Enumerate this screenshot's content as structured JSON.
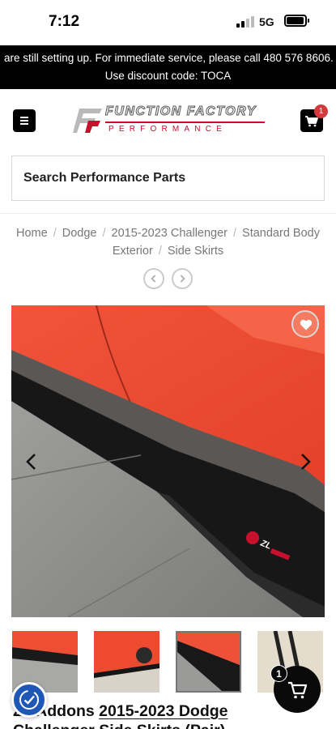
{
  "status_bar": {
    "time": "7:12",
    "network": "5G"
  },
  "announcement": {
    "line1": "are still setting up. For immediate service, please call 480 576 8606.",
    "line2": "Use discount code: TOCA"
  },
  "header": {
    "logo_title": "FUNCTION FACTORY",
    "logo_subtitle": "PERFORMANCE",
    "cart_count": "1"
  },
  "search": {
    "placeholder": "Search Performance Parts"
  },
  "breadcrumb": {
    "items": [
      "Home",
      "Dodge",
      "2015-2023 Challenger",
      "Standard Body Exterior",
      "Side Skirts"
    ]
  },
  "gallery": {
    "thumbnail_count": 4,
    "active_thumbnail": 3
  },
  "product": {
    "title_prefix": "ZL Addons ",
    "title_link": "2015-2023 Dodge",
    "title_rest": "Challenger Side Skirts (Pair)"
  },
  "floating_cart": {
    "count": "1"
  },
  "colors": {
    "accent_red": "#c8102e",
    "car_orange": "#f04f2c",
    "access_blue": "#1e57b5"
  }
}
